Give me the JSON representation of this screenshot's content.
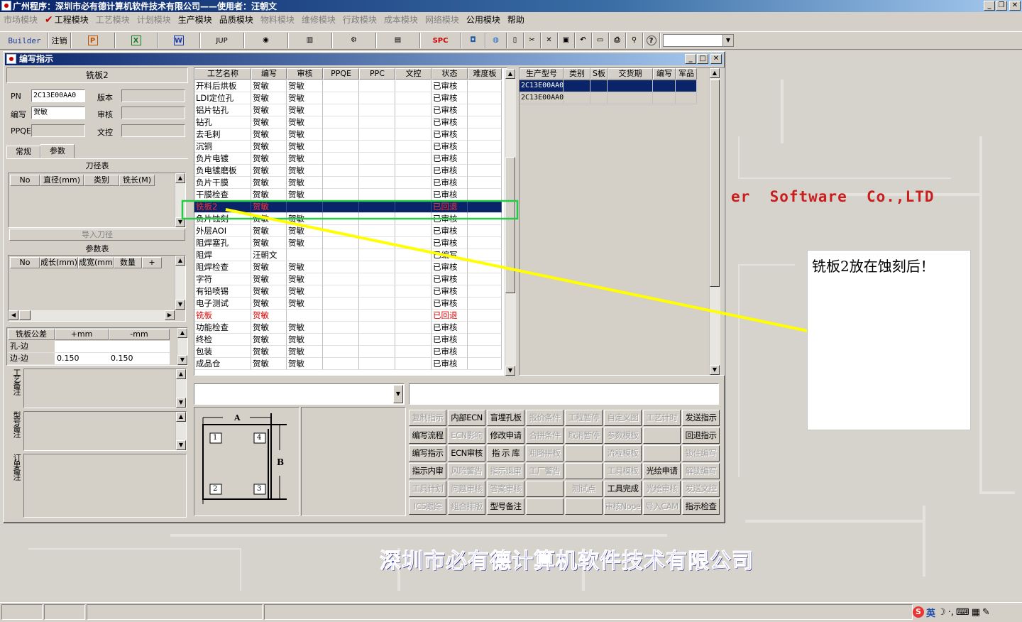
{
  "window": {
    "title": "广州程序：深圳市必有德计算机软件技术有限公司——使用者：汪朝文"
  },
  "menu": [
    {
      "label": "市场模块",
      "enabled": false
    },
    {
      "label": "工程模块",
      "enabled": true,
      "checked": true
    },
    {
      "label": "工艺模块",
      "enabled": false
    },
    {
      "label": "计划模块",
      "enabled": false
    },
    {
      "label": "生产模块",
      "enabled": true
    },
    {
      "label": "品质模块",
      "enabled": true
    },
    {
      "label": "物料模块",
      "enabled": false
    },
    {
      "label": "维修模块",
      "enabled": false
    },
    {
      "label": "行政模块",
      "enabled": false
    },
    {
      "label": "成本模块",
      "enabled": false
    },
    {
      "label": "网络模块",
      "enabled": false
    },
    {
      "label": "公用模块",
      "enabled": true
    },
    {
      "label": "帮助",
      "enabled": true
    }
  ],
  "toolbar": {
    "builder": "Builder",
    "logout": "注销",
    "jup": "JUP",
    "spc": "SPC",
    "icons": [
      "powerpoint-icon",
      "excel-icon",
      "word-icon",
      "eye-icon",
      "database-icon",
      "network-icon",
      "printer-setup-icon",
      "globe-icon",
      "new-doc-icon",
      "cut-icon",
      "delete-icon",
      "save-icon",
      "undo-icon",
      "preview-icon",
      "print-icon",
      "find-icon",
      "help-icon"
    ]
  },
  "child": {
    "title": "编写指示",
    "product_name": "铣板2",
    "fields": {
      "pn_label": "PN",
      "pn_value": "2C13E00AA0",
      "writer_label": "编写",
      "writer_value": "贺敏",
      "ppqe_label": "PPQE",
      "ppqe_value": "",
      "version_label": "版本",
      "version_value": "",
      "review_label": "审核",
      "review_value": "",
      "doc_label": "文控",
      "doc_value": ""
    },
    "tabs": [
      "常规",
      "参数"
    ],
    "tool_table": {
      "title": "刀径表",
      "headers": [
        "No",
        "直径(mm)",
        "类别",
        "铣长(M)"
      ],
      "import_button": "导入刀径"
    },
    "param_table": {
      "title": "参数表",
      "headers": [
        "No",
        "成长(mm)",
        "成宽(mm)",
        "数量",
        "+"
      ]
    },
    "tolerance_table": {
      "headers": [
        "铣板公差",
        "+mm",
        "-mm"
      ],
      "rows": [
        [
          "孔-边",
          "",
          ""
        ],
        [
          "边-边",
          "0.150",
          "0.150"
        ]
      ]
    },
    "remarks": [
      "工艺备注",
      "型号备注",
      "订单备注"
    ],
    "process_grid": {
      "headers": [
        "工艺名称",
        "编写",
        "审核",
        "PPQE",
        "PPC",
        "文控",
        "状态",
        "难度板"
      ],
      "rows": [
        {
          "name": "开料后烘板",
          "writer": "贺敏",
          "reviewer": "贺敏",
          "status": "已审核"
        },
        {
          "name": "LDI定位孔",
          "writer": "贺敏",
          "reviewer": "贺敏",
          "status": "已审核"
        },
        {
          "name": "铝片钻孔",
          "writer": "贺敏",
          "reviewer": "贺敏",
          "status": "已审核"
        },
        {
          "name": "钻孔",
          "writer": "贺敏",
          "reviewer": "贺敏",
          "status": "已审核"
        },
        {
          "name": "去毛刺",
          "writer": "贺敏",
          "reviewer": "贺敏",
          "status": "已审核"
        },
        {
          "name": "沉铜",
          "writer": "贺敏",
          "reviewer": "贺敏",
          "status": "已审核"
        },
        {
          "name": "负片电镀",
          "writer": "贺敏",
          "reviewer": "贺敏",
          "status": "已审核"
        },
        {
          "name": "负电镀磨板",
          "writer": "贺敏",
          "reviewer": "贺敏",
          "status": "已审核"
        },
        {
          "name": "负片干膜",
          "writer": "贺敏",
          "reviewer": "贺敏",
          "status": "已审核"
        },
        {
          "name": "干膜检查",
          "writer": "贺敏",
          "reviewer": "贺敏",
          "status": "已审核"
        },
        {
          "name": "铣板2",
          "writer": "贺敏",
          "reviewer": "",
          "status": "已回退",
          "red": true,
          "selected": true
        },
        {
          "name": "负片蚀刻",
          "writer": "贺敏",
          "reviewer": "贺敏",
          "status": "已审核"
        },
        {
          "name": "外层AOI",
          "writer": "贺敏",
          "reviewer": "贺敏",
          "status": "已审核"
        },
        {
          "name": "阻焊塞孔",
          "writer": "贺敏",
          "reviewer": "贺敏",
          "status": "已审核"
        },
        {
          "name": "阻焊",
          "writer": "汪朝文",
          "reviewer": "",
          "status": "已编写"
        },
        {
          "name": "阻焊检查",
          "writer": "贺敏",
          "reviewer": "贺敏",
          "status": "已审核"
        },
        {
          "name": "字符",
          "writer": "贺敏",
          "reviewer": "贺敏",
          "status": "已审核"
        },
        {
          "name": "有铅喷锡",
          "writer": "贺敏",
          "reviewer": "贺敏",
          "status": "已审核"
        },
        {
          "name": "电子测试",
          "writer": "贺敏",
          "reviewer": "贺敏",
          "status": "已审核"
        },
        {
          "name": "铣板",
          "writer": "贺敏",
          "reviewer": "",
          "status": "已回退",
          "red": true
        },
        {
          "name": "功能检查",
          "writer": "贺敏",
          "reviewer": "贺敏",
          "status": "已审核"
        },
        {
          "name": "终检",
          "writer": "贺敏",
          "reviewer": "贺敏",
          "status": "已审核"
        },
        {
          "name": "包装",
          "writer": "贺敏",
          "reviewer": "贺敏",
          "status": "已审核"
        },
        {
          "name": "成品仓",
          "writer": "贺敏",
          "reviewer": "贺敏",
          "status": "已审核"
        }
      ]
    },
    "model_grid": {
      "headers": [
        "生产型号",
        "类别",
        "S板",
        "交货期",
        "编写",
        "军品"
      ],
      "rows": [
        {
          "model": "2C13E00AA0",
          "selected": true
        },
        {
          "model": "2C13E00AA0",
          "selected": false
        }
      ]
    },
    "diagram": {
      "a": "A",
      "b": "B",
      "n1": "1",
      "n2": "2",
      "n3": "3",
      "n4": "4"
    },
    "buttons": [
      [
        {
          "l": "复制指示",
          "e": false
        },
        {
          "l": "内部ECN",
          "e": true
        },
        {
          "l": "盲埋孔板",
          "e": true
        },
        {
          "l": "报价条件",
          "e": false
        },
        {
          "l": "工程暂停",
          "e": false
        },
        {
          "l": "自定义图",
          "e": false
        },
        {
          "l": "工艺计时",
          "e": false
        },
        {
          "l": "发送指示",
          "e": true
        }
      ],
      [
        {
          "l": "编写流程",
          "e": true
        },
        {
          "l": "ECN影响",
          "e": false
        },
        {
          "l": "修改申请",
          "e": true
        },
        {
          "l": "合拼条件",
          "e": false
        },
        {
          "l": "取消暂停",
          "e": false
        },
        {
          "l": "参数模板",
          "e": false
        },
        {
          "l": "",
          "e": false
        },
        {
          "l": "回退指示",
          "e": true
        }
      ],
      [
        {
          "l": "编写指示",
          "e": true
        },
        {
          "l": "ECN审核",
          "e": true
        },
        {
          "l": "指 示 库",
          "e": true
        },
        {
          "l": "粗略拼板",
          "e": false
        },
        {
          "l": "",
          "e": false
        },
        {
          "l": "流程模板",
          "e": false
        },
        {
          "l": "",
          "e": false
        },
        {
          "l": "锁住编写",
          "e": false
        }
      ],
      [
        {
          "l": "指示内审",
          "e": true
        },
        {
          "l": "风险警告",
          "e": false
        },
        {
          "l": "指示退审",
          "e": false
        },
        {
          "l": "工厂警告",
          "e": false
        },
        {
          "l": "",
          "e": false
        },
        {
          "l": "工具模板",
          "e": false
        },
        {
          "l": "光绘申请",
          "e": true
        },
        {
          "l": "解锁编写",
          "e": false
        }
      ],
      [
        {
          "l": "工具计划",
          "e": false
        },
        {
          "l": "问题审核",
          "e": false
        },
        {
          "l": "答案审核",
          "e": false
        },
        {
          "l": "",
          "e": false
        },
        {
          "l": "测试点",
          "e": false
        },
        {
          "l": "工具完成",
          "e": true
        },
        {
          "l": "光绘审核",
          "e": false
        },
        {
          "l": "发送文控",
          "e": false
        }
      ],
      [
        {
          "l": "ICS跟踪",
          "e": false
        },
        {
          "l": "组合排版",
          "e": false
        },
        {
          "l": "型号备注",
          "e": true
        },
        {
          "l": "",
          "e": false
        },
        {
          "l": "",
          "e": false
        },
        {
          "l": "审核Nope",
          "e": false
        },
        {
          "l": "导入CAM",
          "e": false
        },
        {
          "l": "指示检查",
          "e": true
        }
      ]
    ]
  },
  "background": {
    "company_en": "er  Software  Co.,LTD",
    "company_cn": "深圳市必有德计算机软件技术有限公司"
  },
  "annotation": {
    "note": "铣板2放在蚀刻后！",
    "highlight_color": "#22cc44",
    "arrow_color": "#ffff00"
  },
  "taskbar": {
    "ime": "英"
  }
}
